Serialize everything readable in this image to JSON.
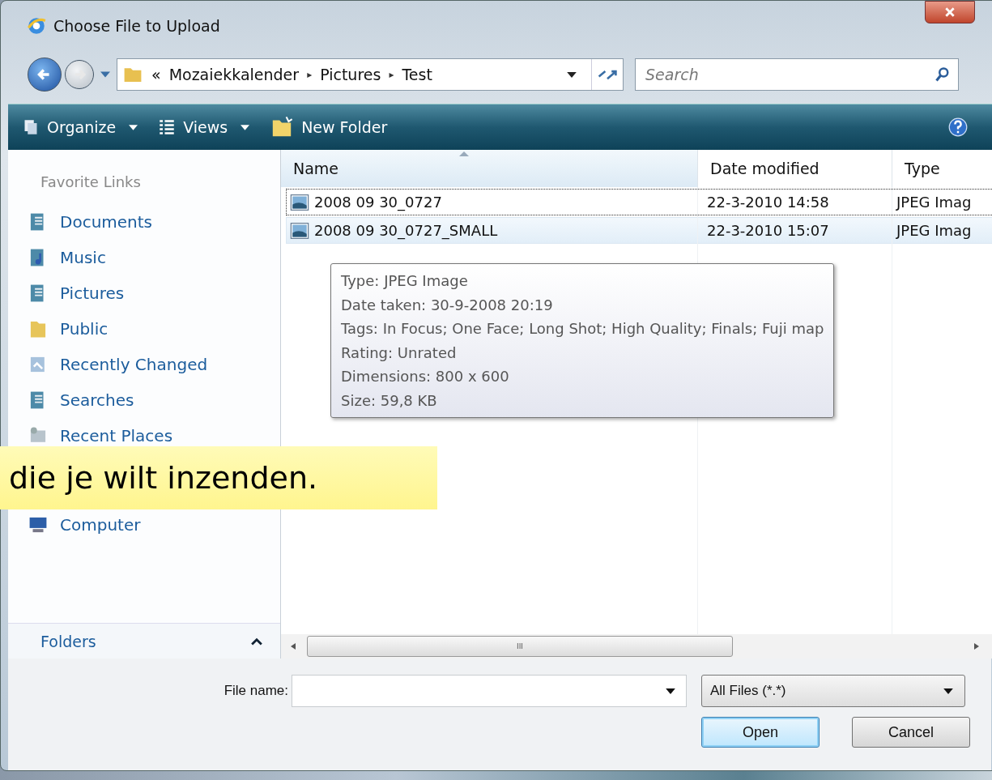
{
  "window": {
    "title": "Choose File to Upload"
  },
  "address_bar": {
    "overflow": "«",
    "path": [
      "Mozaiekkalender",
      "Pictures",
      "Test"
    ],
    "separator": "▸"
  },
  "search": {
    "placeholder": "Search"
  },
  "toolbar": [
    {
      "label": "Organize",
      "kind": "organize"
    },
    {
      "label": "Views",
      "kind": "views"
    },
    {
      "label": "New Folder",
      "kind": "folder"
    }
  ],
  "sidebar": {
    "heading": "Favorite Links",
    "items": [
      {
        "label": "Documents",
        "kind": "documents"
      },
      {
        "label": "Music",
        "kind": "music"
      },
      {
        "label": "Pictures",
        "kind": "pictures"
      },
      {
        "label": "Public",
        "kind": "public"
      },
      {
        "label": "Recently Changed",
        "kind": "recent"
      },
      {
        "label": "Searches",
        "kind": "searches"
      },
      {
        "label": "Recent Places",
        "kind": "places"
      },
      {
        "label": "Computer",
        "kind": "computer"
      }
    ],
    "folders": {
      "label": "Folders",
      "expanded": false
    }
  },
  "table": {
    "columns": [
      "Name",
      "Date modified",
      "Type"
    ],
    "rows": [
      {
        "name": "2008 09 30_0727",
        "date": "22-3-2010 14:58",
        "type": "JPEG Imag",
        "selected": false,
        "focused": true
      },
      {
        "name": "2008 09 30_0727_SMALL",
        "date": "22-3-2010 15:07",
        "type": "JPEG Imag",
        "selected": true,
        "focused": false
      }
    ]
  },
  "tooltip": [
    "Type: JPEG Image",
    "Date taken: 30-9-2008 20:19",
    "Tags: In Focus; One Face; Long Shot; High Quality; Finals; Fuji map",
    "Rating: Unrated",
    "Dimensions: 800 x 600",
    "Size: 59,8 KB"
  ],
  "scrollbar_label": "III",
  "file_name": {
    "label": "File name:"
  },
  "file_type": {
    "value": "All Files (*.*)"
  },
  "buttons": [
    {
      "label": "Open",
      "default": true
    },
    {
      "label": "Cancel",
      "default": false
    }
  ],
  "caption": "die je wilt inzenden."
}
